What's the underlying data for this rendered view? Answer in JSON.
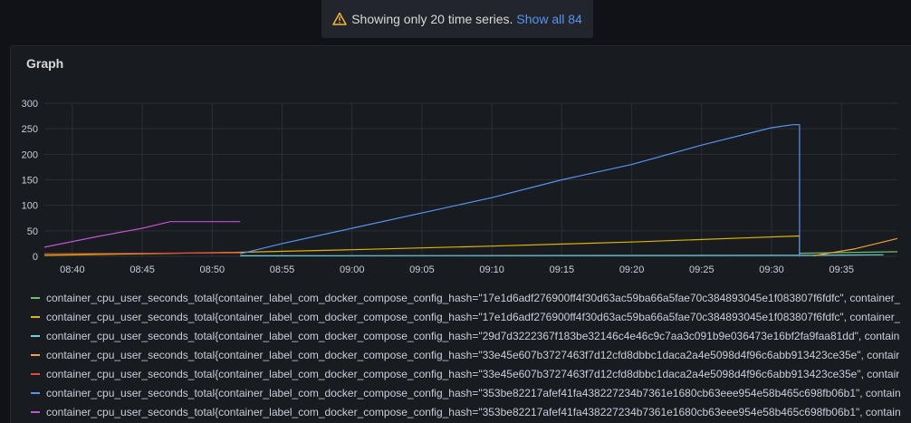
{
  "notice": {
    "text": "Showing only 20 time series.",
    "link": "Show all 84",
    "icon": "warning-icon"
  },
  "panel": {
    "title": "Graph"
  },
  "chart_data": {
    "type": "line",
    "title": "Graph",
    "xlabel": "",
    "ylabel": "",
    "ylim": [
      0,
      300
    ],
    "yticks": [
      0,
      50,
      100,
      150,
      200,
      250,
      300
    ],
    "xlim": [
      "08:38",
      "09:39"
    ],
    "xticks": [
      "08:40",
      "08:45",
      "08:50",
      "08:55",
      "09:00",
      "09:05",
      "09:10",
      "09:15",
      "09:20",
      "09:25",
      "09:30",
      "09:35"
    ],
    "grid": true,
    "legend_position": "bottom",
    "series": [
      {
        "color": "#73bf69",
        "x": [
          "09:32",
          "09:39"
        ],
        "y": [
          6,
          9
        ]
      },
      {
        "color": "#e0b400",
        "x": [
          "08:38",
          "08:52",
          "09:00",
          "09:10",
          "09:20",
          "09:28",
          "09:32",
          "09:32"
        ],
        "y": [
          2,
          8,
          13,
          20,
          28,
          36,
          40,
          2
        ]
      },
      {
        "color": "#6ed0e0",
        "x": [
          "08:52",
          "09:32",
          "09:38"
        ],
        "y": [
          1,
          2,
          3
        ]
      },
      {
        "color": "#f2a037",
        "x": [
          "09:33",
          "09:36",
          "09:39"
        ],
        "y": [
          1,
          15,
          35
        ]
      },
      {
        "color": "#e24d42",
        "x": [
          "08:38",
          "08:52"
        ],
        "y": [
          5,
          7
        ]
      },
      {
        "color": "#5794f2",
        "x": [
          "08:52",
          "08:55",
          "09:00",
          "09:05",
          "09:10",
          "09:15",
          "09:20",
          "09:25",
          "09:30",
          "09:31.5",
          "09:32",
          "09:32"
        ],
        "y": [
          5,
          25,
          55,
          85,
          115,
          150,
          180,
          218,
          252,
          258,
          258,
          0
        ]
      },
      {
        "color": "#c054d1",
        "x": [
          "08:38",
          "08:42",
          "08:45",
          "08:47",
          "08:50",
          "08:52"
        ],
        "y": [
          18,
          40,
          55,
          68,
          68,
          68
        ]
      }
    ]
  },
  "legend": {
    "items": [
      {
        "color": "#73bf69",
        "label": "container_cpu_user_seconds_total{container_label_com_docker_compose_config_hash=\"17e1d6adf276900ff4f30d63ac59ba66a5fae70c384893045e1f083807f6fdfc\", container_"
      },
      {
        "color": "#e0b400",
        "label": "container_cpu_user_seconds_total{container_label_com_docker_compose_config_hash=\"17e1d6adf276900ff4f30d63ac59ba66a5fae70c384893045e1f083807f6fdfc\", container_"
      },
      {
        "color": "#6ed0e0",
        "label": "container_cpu_user_seconds_total{container_label_com_docker_compose_config_hash=\"29d7d3222367f183be32146c4e46c9c7aa3c091b9e036473e16bf2fa9faa81dd\", contain"
      },
      {
        "color": "#f2a037",
        "label": "container_cpu_user_seconds_total{container_label_com_docker_compose_config_hash=\"33e45e607b3727463f7d12cfd8dbbc1daca2a4e5098d4f96c6abb913423ce35e\", contair"
      },
      {
        "color": "#e24d42",
        "label": "container_cpu_user_seconds_total{container_label_com_docker_compose_config_hash=\"33e45e607b3727463f7d12cfd8dbbc1daca2a4e5098d4f96c6abb913423ce35e\", contair"
      },
      {
        "color": "#5794f2",
        "label": "container_cpu_user_seconds_total{container_label_com_docker_compose_config_hash=\"353be82217afef41fa438227234b7361e1680cb63eee954e58b465c698fb06b1\", contain"
      },
      {
        "color": "#c054d1",
        "label": "container_cpu_user_seconds_total{container_label_com_docker_compose_config_hash=\"353be82217afef41fa438227234b7361e1680cb63eee954e58b465c698fb06b1\", contain"
      }
    ]
  }
}
